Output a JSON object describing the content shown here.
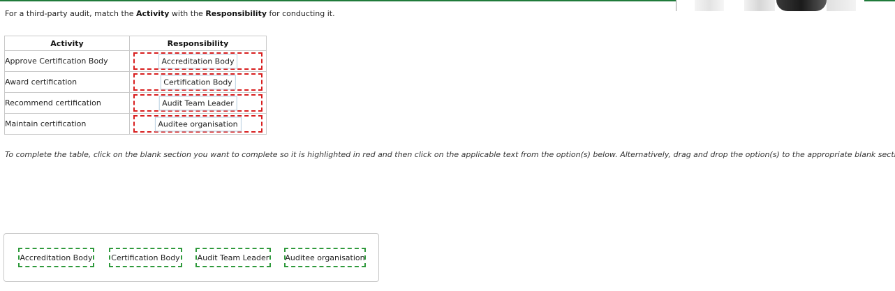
{
  "question": {
    "prefix": "For a third-party audit, match the ",
    "term_activity": "Activity",
    "middle": " with the ",
    "term_responsibility": "Responsibility",
    "suffix": " for conducting it."
  },
  "table": {
    "headers": {
      "activity": "Activity",
      "responsibility": "Responsibility"
    },
    "rows": [
      {
        "activity": "Approve Certification Body",
        "responsibility": "Accreditation Body"
      },
      {
        "activity": "Award certification",
        "responsibility": "Certification Body"
      },
      {
        "activity": "Recommend certification",
        "responsibility": "Audit Team Leader"
      },
      {
        "activity": "Maintain certification",
        "responsibility": "Auditee organisation"
      }
    ]
  },
  "instructions": "To complete the table, click on the blank section you want to complete so it is highlighted in red and then click on the applicable text from the option(s) below. Alternatively, drag and drop the option(s) to the appropriate blank section.",
  "options": [
    {
      "label": "Accreditation Body"
    },
    {
      "label": "Certification Body"
    },
    {
      "label": "Audit Team Leader"
    },
    {
      "label": "Auditee organisation"
    }
  ],
  "colors": {
    "dropzone_border": "#d81e1e",
    "option_border": "#2f9a3c",
    "top_accent": "#1f7a3a"
  }
}
